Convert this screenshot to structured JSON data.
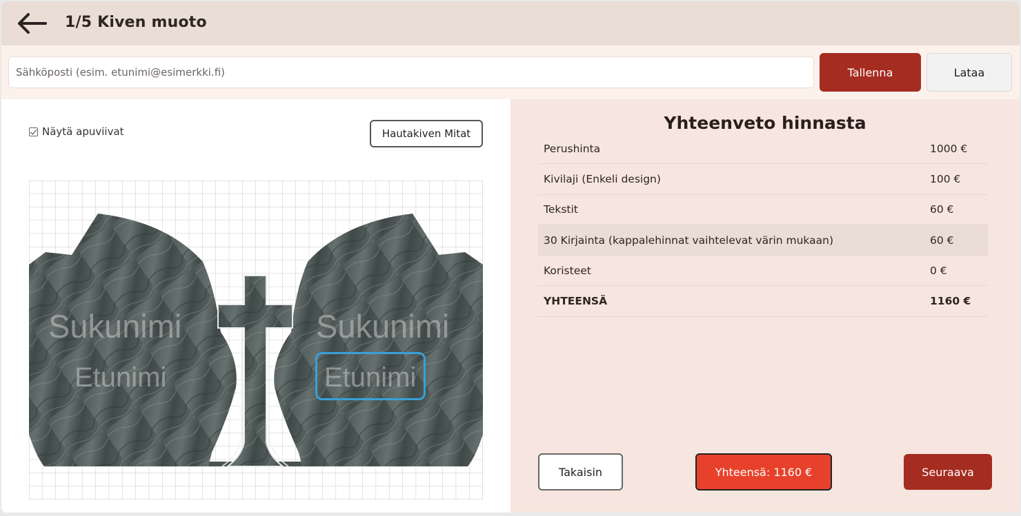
{
  "header": {
    "step_title": "1/5 Kiven muoto"
  },
  "email_bar": {
    "email_placeholder": "Sähköposti (esim. etunimi@esimerkki.fi)",
    "email_value": "",
    "save_label": "Tallenna",
    "load_label": "Lataa"
  },
  "editor": {
    "show_guides_label": "Näytä apuviivat",
    "show_guides_checked": true,
    "dimensions_button_label": "Hautakiven Mitat",
    "stone": {
      "left_surname": "Sukunimi",
      "left_firstname": "Etunimi",
      "right_surname": "Sukunimi",
      "right_firstname": "Etunimi"
    }
  },
  "summary": {
    "title": "Yhteenveto hinnasta",
    "rows": [
      {
        "label": "Perushinta",
        "value": "1000 €"
      },
      {
        "label": "Kivilaji (Enkeli design)",
        "value": "100 €"
      },
      {
        "label": "Tekstit",
        "value": "60 €"
      },
      {
        "label": "30 Kirjainta (kappalehinnat vaihtelevat värin mukaan)",
        "value": "60 €"
      },
      {
        "label": "Koristeet",
        "value": "0 €"
      },
      {
        "label": "YHTEENSÄ",
        "value": "1160 €"
      }
    ]
  },
  "footer": {
    "back_label": "Takaisin",
    "total_label": "Yhteensä: 1160 €",
    "next_label": "Seuraava"
  },
  "colors": {
    "header_bg": "#eaddd6",
    "accent_dark_red": "#a52c20",
    "accent_red": "#e8412b",
    "summary_bg": "#f7e6df",
    "selection_blue": "#3aa0d8"
  }
}
